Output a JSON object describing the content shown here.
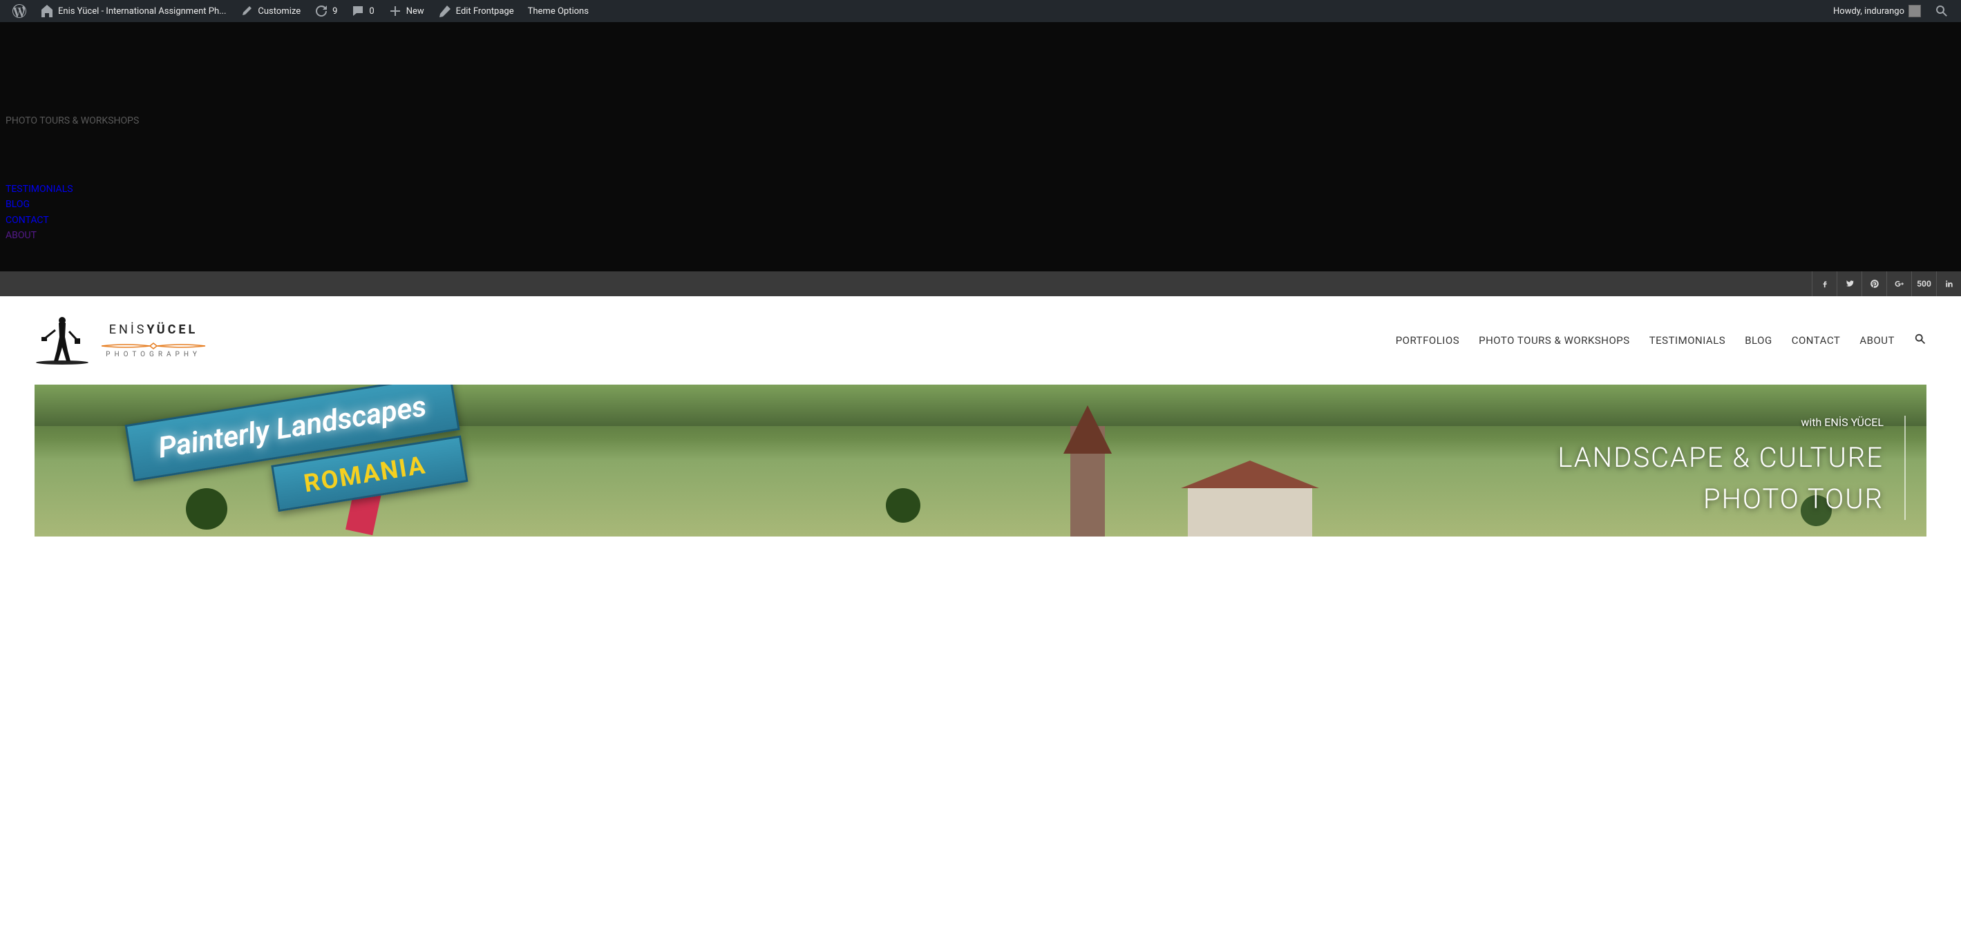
{
  "admin_bar": {
    "site_title": "Enis Yücel - International Assignment Ph...",
    "customize": "Customize",
    "updates_count": "9",
    "comments_count": "0",
    "new": "New",
    "edit_frontpage": "Edit Frontpage",
    "theme_options": "Theme Options",
    "howdy": "Howdy, indurango"
  },
  "black_menu": {
    "photo_tours": "PHOTO TOURS & WORKSHOPS",
    "testimonials": "TESTIMONIALS",
    "blog": "BLOG",
    "contact": "CONTACT",
    "about": "ABOUT"
  },
  "social": {
    "facebook": "facebook",
    "twitter": "twitter",
    "pinterest": "pinterest",
    "googleplus": "google-plus",
    "fivehundredpx": "500",
    "linkedin": "linkedin"
  },
  "logo": {
    "name_first": "ENİS",
    "name_last": "YÜCEL",
    "subtitle": "PHOTOGRAPHY"
  },
  "main_nav": {
    "portfolios": "PORTFOLIOS",
    "photo_tours": "PHOTO TOURS & WORKSHOPS",
    "testimonials": "TESTIMONIALS",
    "blog": "BLOG",
    "contact": "CONTACT",
    "about": "ABOUT"
  },
  "hero": {
    "ribbon_main": "Painterly Landscapes",
    "ribbon_sub": "ROMANIA",
    "with_text": "with ENİS YÜCEL",
    "title_line1": "LANDSCAPE & CULTURE",
    "title_line2": "PHOTO TOUR"
  }
}
